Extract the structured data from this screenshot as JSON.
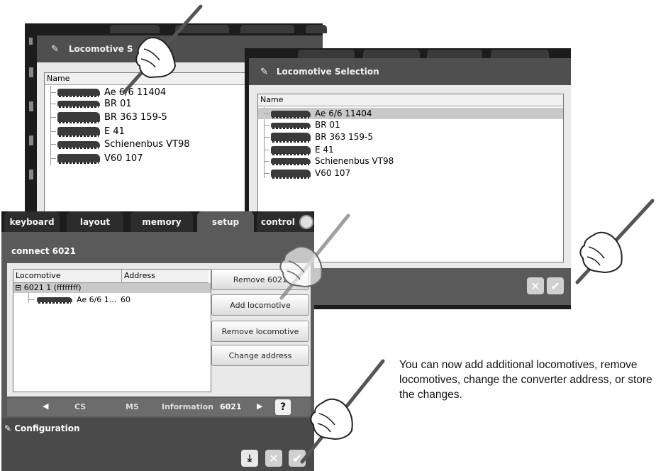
{
  "colors": {
    "dark_frame": "#1c1c1c",
    "title_bar": "#4f4f4f",
    "panel": "#e9e9e9",
    "selection": "#c9c9c9",
    "hand_pen": "#555555"
  },
  "back_window": {
    "title": "Locomotive S",
    "column_name": "Name",
    "items": [
      "Ae 6/6 11404",
      "BR 01",
      "BR 363 159-5",
      "E 41",
      "Schienenbus VT98",
      "V60 107"
    ]
  },
  "front_window": {
    "title": "Locomotive Selection",
    "column_name": "Name",
    "items": [
      "Ae 6/6 11404",
      "BR 01",
      "BR 363 159-5",
      "E 41",
      "Schienenbus VT98",
      "V60 107"
    ],
    "selected_index": 0
  },
  "setup_window": {
    "tabs": [
      "keyboard",
      "layout",
      "memory",
      "setup",
      "control"
    ],
    "active_tab": "setup",
    "heading": "connect 6021",
    "table_headers": [
      "Locomotive",
      "Address"
    ],
    "group_row": "6021 1 (ffffffff)",
    "loco_row": {
      "name": "Ae 6/6 1...",
      "address": "60"
    },
    "buttons": {
      "remove_6021": "Remove 6021",
      "add_locomotive": "Add locomotive",
      "remove_locomotive": "Remove locomotive",
      "change_address": "Change address"
    },
    "nav": [
      "CS",
      "MS",
      "Information",
      "6021"
    ],
    "nav_active": "6021",
    "help": "?",
    "config_title": "Configuration"
  },
  "note": "You can now add additional locomotives, remove locomotives, change the converter address, or store the changes.",
  "icons": [
    "wrench-icon",
    "close-icon",
    "check-icon",
    "save-icon",
    "clock-icon",
    "chevron-left-icon",
    "chevron-right-icon",
    "hand-pen-icon"
  ]
}
